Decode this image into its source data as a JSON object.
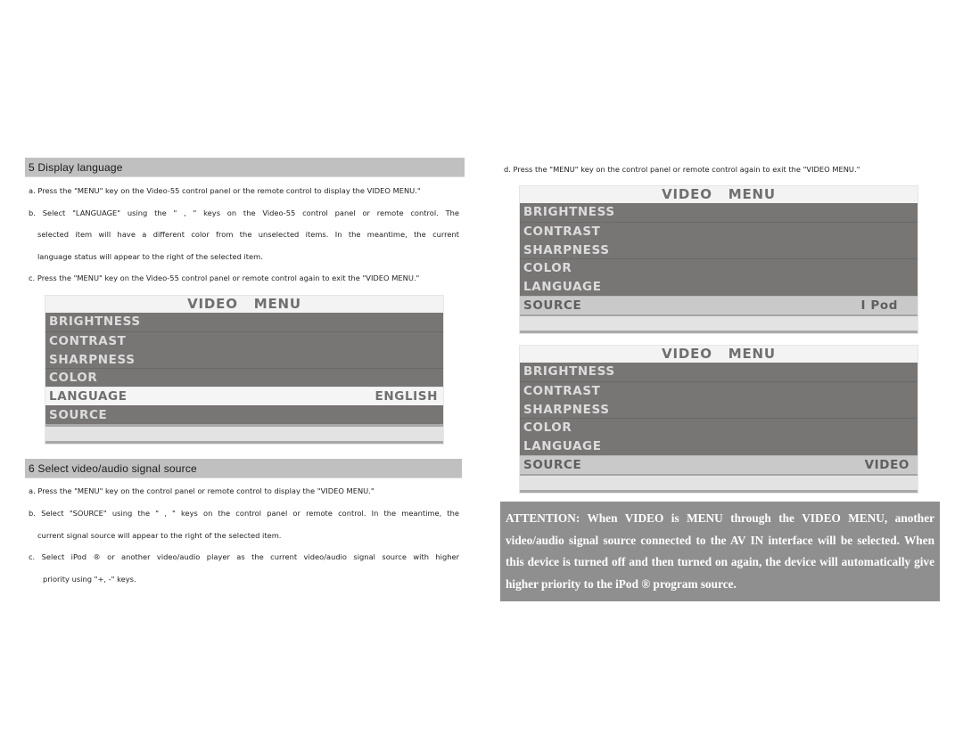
{
  "section5": {
    "title": "5 Display language",
    "steps": {
      "a": "a. Press the \"MENU\" key on the Video-55 control panel or the remote control to display the VIDEO MENU.\"",
      "b1": "b.  Select  \"LANGUAGE\"  using  the  \" ,    \"  keys  on  the  Video-55  control  panel  or  remote  control.  The",
      "b2": "selected  item  will  have  a  different  color  from  the  unselected  items.  In  the  meantime,  the  current",
      "b3": "language status will appear to the right of the selected item.",
      "c": "c. Press the \"MENU\" key on the Video-55 control panel or remote control again to exit the \"VIDEO MENU.\""
    }
  },
  "menu_language": {
    "title": "VIDEO MENU",
    "items": [
      {
        "label": "BRIGHTNESS",
        "value": ""
      },
      {
        "label": "CONTRAST",
        "value": ""
      },
      {
        "label": "SHARPNESS",
        "value": ""
      },
      {
        "label": "COLOR",
        "value": ""
      },
      {
        "label": "LANGUAGE",
        "value": "ENGLISH",
        "selected": true
      },
      {
        "label": "SOURCE",
        "value": ""
      }
    ]
  },
  "section6": {
    "title": "6 Select video/audio signal source",
    "steps": {
      "a": "a. Press the \"MENU\" key on the control panel or remote control to display the \"VIDEO MENU.\"",
      "b1": "b. Select \"SOURCE\" using the \" ,    \" keys on the control panel or remote control. In the meantime, the",
      "b2": "current signal source will appear to the right of the selected item.",
      "c1": "c.  Select  iPod  ®  or  another  video/audio  player  as  the  current  video/audio  signal  source  with  higher",
      "c2": "priority using \"+, -\" keys."
    }
  },
  "step_d": "d. Press the \"MENU\" key on the control panel or remote control again to exit the \"VIDEO MENU.\"",
  "menu_source_ipod": {
    "title": "VIDEO MENU",
    "items": [
      {
        "label": "BRIGHTNESS",
        "value": ""
      },
      {
        "label": "CONTRAST",
        "value": ""
      },
      {
        "label": "SHARPNESS",
        "value": ""
      },
      {
        "label": "COLOR",
        "value": ""
      },
      {
        "label": "LANGUAGE",
        "value": ""
      },
      {
        "label": "SOURCE",
        "value": "I Pod",
        "selected": true
      }
    ]
  },
  "menu_source_video": {
    "title": "VIDEO MENU",
    "items": [
      {
        "label": "BRIGHTNESS",
        "value": ""
      },
      {
        "label": "CONTRAST",
        "value": ""
      },
      {
        "label": "SHARPNESS",
        "value": ""
      },
      {
        "label": "COLOR",
        "value": ""
      },
      {
        "label": "LANGUAGE",
        "value": ""
      },
      {
        "label": "SOURCE",
        "value": "VIDEO",
        "selected": true
      }
    ]
  },
  "attention": {
    "text": "ATTENTION: When VIDEO is MENU through the VIDEO MENU, another video/audio signal source connected to the AV IN interface will be selected. When this device is turned off and then turned on again, the device will automatically give higher priority to the iPod ® program source."
  },
  "colors": {
    "section_header_bg": "#c0c0c0",
    "menu_row_bg": "#787575",
    "menu_row_text": "#dcdcdc",
    "menu_selected_light_bg": "#f5f5f5",
    "menu_selected_gray_bg": "#c9c9c9",
    "attention_bg": "#8f8f8f"
  }
}
